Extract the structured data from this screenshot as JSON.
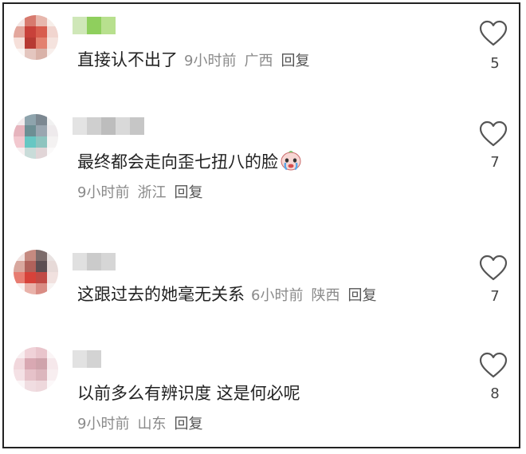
{
  "comments": [
    {
      "text": "直接认不出了",
      "time": "9小时前",
      "location": "广西",
      "reply": "回复",
      "likes": "5",
      "avatar_colors": [
        "#f4e6e4",
        "#d77a6e",
        "#e7b7ad",
        "#f7eee9",
        "#e3a79d",
        "#c8413a",
        "#d85d4e",
        "#f1d5cf",
        "#f6e0da",
        "#b73a33",
        "#e3816f",
        "#f5e3de",
        "#fbf5f3",
        "#e4c6bf",
        "#d9b2a8",
        "#f8efec"
      ],
      "name_colors": [
        "#cfe7b8",
        "#8fcf5d",
        "#b8e08e"
      ]
    },
    {
      "text": "最终都会走向歪七扭八的脸",
      "emoji": "crying-face-emoji",
      "time": "9小时前",
      "location": "浙江",
      "reply": "回复",
      "likes": "7",
      "avatar_colors": [
        "#f3ecee",
        "#8ea4ad",
        "#7c8891",
        "#f1f1f1",
        "#e6b4bd",
        "#6d8f94",
        "#9aa6b0",
        "#eeeaec",
        "#f2c8cf",
        "#67c7c3",
        "#8ec4bf",
        "#f4f2f2",
        "#f7f0f1",
        "#c9dcd9",
        "#e1d5d7",
        "#fbfafa"
      ],
      "name_colors": [
        "#e3e3e3",
        "#cfcfcf",
        "#bdbdbd",
        "#d9d9d9",
        "#c6c6c6"
      ]
    },
    {
      "text": "这跟过去的她毫无关系",
      "time": "6小时前",
      "location": "陕西",
      "reply": "回复",
      "likes": "7",
      "avatar_colors": [
        "#f2e3e1",
        "#c58a80",
        "#7d6c6b",
        "#e9e2e1",
        "#d8a79e",
        "#b0625b",
        "#5c4e52",
        "#e7dad8",
        "#e77c71",
        "#d7423a",
        "#c04a45",
        "#f1e1df",
        "#f9efed",
        "#e9b2aa",
        "#d98c84",
        "#f8f3f2"
      ],
      "name_colors": [
        "#e0e0e0",
        "#cbcbcb",
        "#d6d6d6"
      ]
    },
    {
      "text": "以前多么有辨识度 这是何必呢",
      "time": "9小时前",
      "location": "山东",
      "reply": "回复",
      "likes": "8",
      "avatar_colors": [
        "#f8eef0",
        "#f0d2d8",
        "#e9c5cc",
        "#fbf5f6",
        "#f1d7dc",
        "#d9a8b2",
        "#cfa3ab",
        "#f6e8eb",
        "#f4e1e5",
        "#e6c2c9",
        "#dcb6bd",
        "#f8eef0",
        "#fbf6f7",
        "#f0dde1",
        "#eed8dc",
        "#fcf8f9"
      ],
      "name_colors": [
        "#e2e2e2",
        "#d3d3d3"
      ]
    }
  ]
}
